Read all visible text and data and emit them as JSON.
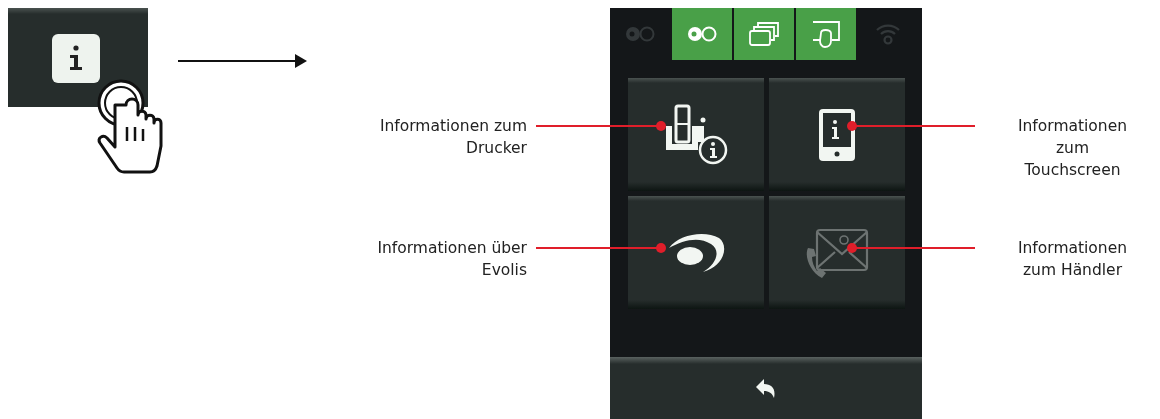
{
  "status_icons": [
    {
      "kind": "ribbon",
      "active": false
    },
    {
      "kind": "ribbon",
      "active": true
    },
    {
      "kind": "cards",
      "active": true
    },
    {
      "kind": "touch",
      "active": true
    },
    {
      "kind": "wifi",
      "active": false
    }
  ],
  "tiles": [
    {
      "kind": "printer-info",
      "callout": "Informationen zum\nDrucker"
    },
    {
      "kind": "screen-info",
      "callout": "Informationen\nzum\nTouchscreen"
    },
    {
      "kind": "evolis-logo",
      "callout": "Informationen über\nEvolis"
    },
    {
      "kind": "contact",
      "callout": "Informationen\nzum Händler"
    }
  ]
}
